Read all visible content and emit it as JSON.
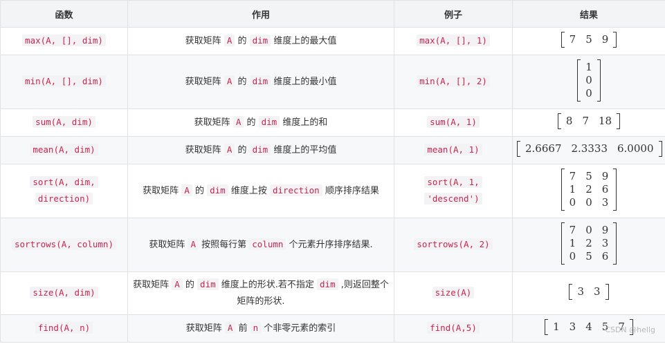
{
  "headers": [
    "函数",
    "作用",
    "例子",
    "结果"
  ],
  "rows": [
    {
      "fn": [
        "max(A, [], dim)"
      ],
      "desc": [
        {
          "t": "获取矩阵 "
        },
        {
          "c": "A"
        },
        {
          "t": " 的 "
        },
        {
          "c": "dim"
        },
        {
          "t": " 维度上的最大值"
        }
      ],
      "ex": [
        "max(A, [], 1)"
      ],
      "res": {
        "cols": 3,
        "cells": [
          "7",
          "5",
          "9"
        ]
      }
    },
    {
      "fn": [
        "min(A, [], dim)"
      ],
      "desc": [
        {
          "t": "获取矩阵 "
        },
        {
          "c": "A"
        },
        {
          "t": " 的 "
        },
        {
          "c": "dim"
        },
        {
          "t": " 维度上的最小值"
        }
      ],
      "ex": [
        "min(A, [], 2)"
      ],
      "res": {
        "cols": 1,
        "cells": [
          "1",
          "0",
          "0"
        ]
      }
    },
    {
      "fn": [
        "sum(A, dim)"
      ],
      "desc": [
        {
          "t": "获取矩阵 "
        },
        {
          "c": "A"
        },
        {
          "t": " 的 "
        },
        {
          "c": "dim"
        },
        {
          "t": " 维度上的和"
        }
      ],
      "ex": [
        "sum(A, 1)"
      ],
      "res": {
        "cols": 3,
        "cells": [
          "8",
          "7",
          "18"
        ]
      }
    },
    {
      "fn": [
        "mean(A, dim)"
      ],
      "desc": [
        {
          "t": "获取矩阵 "
        },
        {
          "c": "A"
        },
        {
          "t": " 的 "
        },
        {
          "c": "dim"
        },
        {
          "t": " 维度上的平均值"
        }
      ],
      "ex": [
        "mean(A, 1)"
      ],
      "res": {
        "cols": 3,
        "cells": [
          "2.6667",
          "2.3333",
          "6.0000"
        ]
      }
    },
    {
      "fn": [
        "sort(A, dim,",
        "direction)"
      ],
      "desc": [
        {
          "t": "获取矩阵 "
        },
        {
          "c": "A"
        },
        {
          "t": " 的 "
        },
        {
          "c": "dim"
        },
        {
          "t": " 维度上按 "
        },
        {
          "c": "direction"
        },
        {
          "t": " 顺序排序结果"
        }
      ],
      "ex": [
        "sort(A, 1,",
        "'descend')"
      ],
      "res": {
        "cols": 3,
        "cells": [
          "7",
          "5",
          "9",
          "1",
          "2",
          "6",
          "0",
          "0",
          "3"
        ]
      }
    },
    {
      "fn": [
        "sortrows(A, column)"
      ],
      "desc": [
        {
          "t": "获取矩阵 "
        },
        {
          "c": "A"
        },
        {
          "t": " 按照每行第 "
        },
        {
          "c": "column"
        },
        {
          "t": " 个元素升序排序结果."
        }
      ],
      "ex": [
        "sortrows(A, 2)"
      ],
      "res": {
        "cols": 3,
        "cells": [
          "7",
          "0",
          "9",
          "1",
          "2",
          "3",
          "0",
          "5",
          "6"
        ]
      }
    },
    {
      "fn": [
        "size(A, dim)"
      ],
      "desc": [
        {
          "t": "获取矩阵 "
        },
        {
          "c": "A"
        },
        {
          "t": " 的 "
        },
        {
          "c": "dim"
        },
        {
          "t": " 维度上的形状.若不指定 "
        },
        {
          "c": "dim"
        },
        {
          "t": " ,则返回整个"
        },
        {
          "br": true
        },
        {
          "t": "矩阵的形状."
        }
      ],
      "ex": [
        "size(A)"
      ],
      "res": {
        "cols": 2,
        "cells": [
          "3",
          "3"
        ]
      }
    },
    {
      "fn": [
        "find(A, n)"
      ],
      "desc": [
        {
          "t": "获取矩阵 "
        },
        {
          "c": "A"
        },
        {
          "t": " 前 "
        },
        {
          "c": "n"
        },
        {
          "t": " 个非零元素的索引"
        }
      ],
      "ex": [
        "find(A,5)"
      ],
      "res": {
        "cols": 5,
        "cells": [
          "1",
          "3",
          "4",
          "5",
          "7"
        ]
      }
    }
  ],
  "watermark": "CSDN @hellg"
}
